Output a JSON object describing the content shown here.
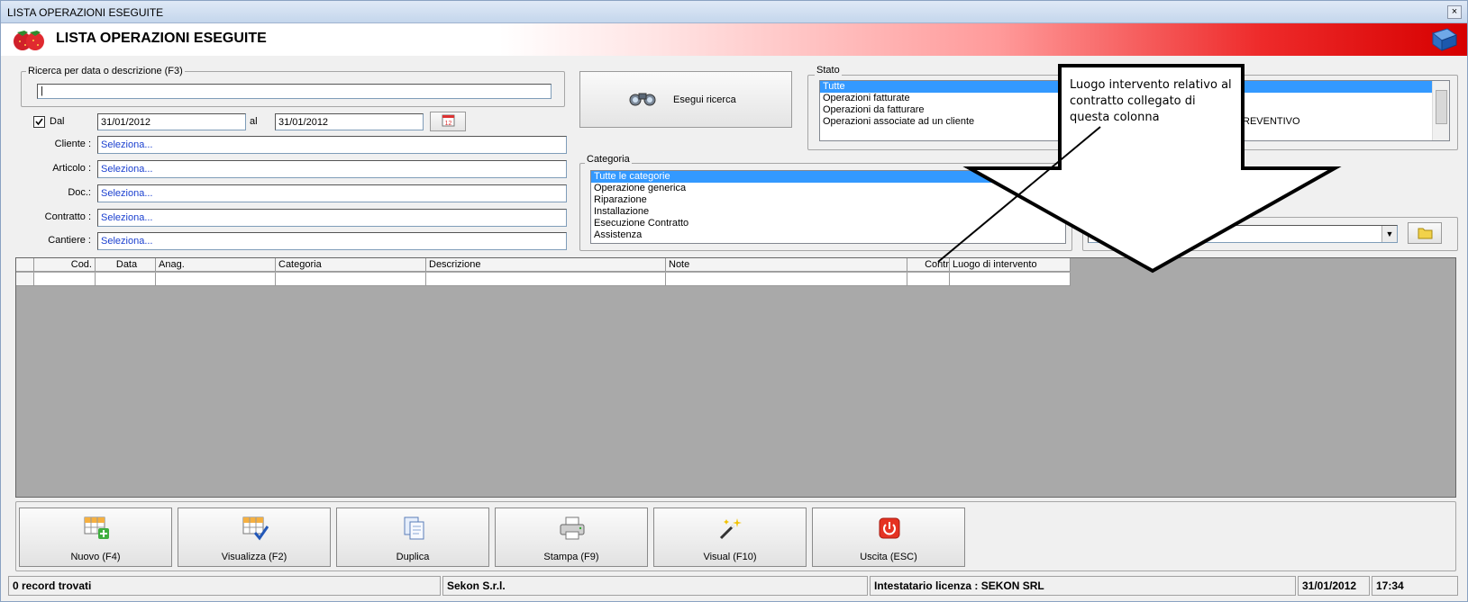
{
  "window": {
    "title": "LISTA OPERAZIONI ESEGUITE",
    "close": "×"
  },
  "header": {
    "title": "LISTA OPERAZIONI ESEGUITE"
  },
  "search": {
    "legend": "Ricerca per data o descrizione (F3)",
    "value": "|"
  },
  "dates": {
    "dal_label": "Dal",
    "dal_checked": true,
    "from": "31/01/2012",
    "al_label": "al",
    "to": "31/01/2012",
    "calendar_text": "12"
  },
  "fields": [
    {
      "label": "Cliente :",
      "value": "Seleziona..."
    },
    {
      "label": "Articolo :",
      "value": "Seleziona..."
    },
    {
      "label": "Doc.:",
      "value": "Seleziona..."
    },
    {
      "label": "Contratto :",
      "value": "Seleziona..."
    },
    {
      "label": "Cantiere :",
      "value": "Seleziona..."
    }
  ],
  "search_button": {
    "label": "Esegui ricerca"
  },
  "stato": {
    "legend": "Stato",
    "items": [
      "Tutte",
      "Operazioni fatturate",
      "Operazioni da fatturare",
      "Operazioni associate ad un cliente"
    ],
    "selected": 0,
    "partial_item": "REVENTIVO"
  },
  "categoria": {
    "legend": "Categoria",
    "items": [
      "Tutte le categorie",
      "Operazione generica",
      "Riparazione",
      "Installazione",
      "Esecuzione Contratto",
      "Assistenza"
    ],
    "selected": 0
  },
  "grid": {
    "columns": [
      "Cod.",
      "Data",
      "Anag.",
      "Categoria",
      "Descrizione",
      "Note",
      "Contr",
      "Luogo di intervento"
    ]
  },
  "callout": {
    "text": "Luogo intervento relativo al contratto collegato  di questa colonna"
  },
  "buttons": [
    {
      "label": "Nuovo (F4)",
      "icon": "grid-add-icon"
    },
    {
      "label": "Visualizza (F2)",
      "icon": "grid-check-icon"
    },
    {
      "label": "Duplica",
      "icon": "copy-documents-icon"
    },
    {
      "label": "Stampa (F9)",
      "icon": "printer-icon"
    },
    {
      "label": "Visual (F10)",
      "icon": "magic-wand-icon"
    },
    {
      "label": "Uscita (ESC)",
      "icon": "power-icon"
    }
  ],
  "statusbar": {
    "records": "0 record trovati",
    "company": "Sekon S.r.l.",
    "license": "Intestatario licenza : SEKON SRL",
    "date": "31/01/2012",
    "time": "17:34"
  },
  "colors": {
    "accent_red": "#d60000",
    "selection": "#3399ff",
    "link_blue": "#1a3fcf",
    "grid_bg": "#a9a9a9"
  }
}
